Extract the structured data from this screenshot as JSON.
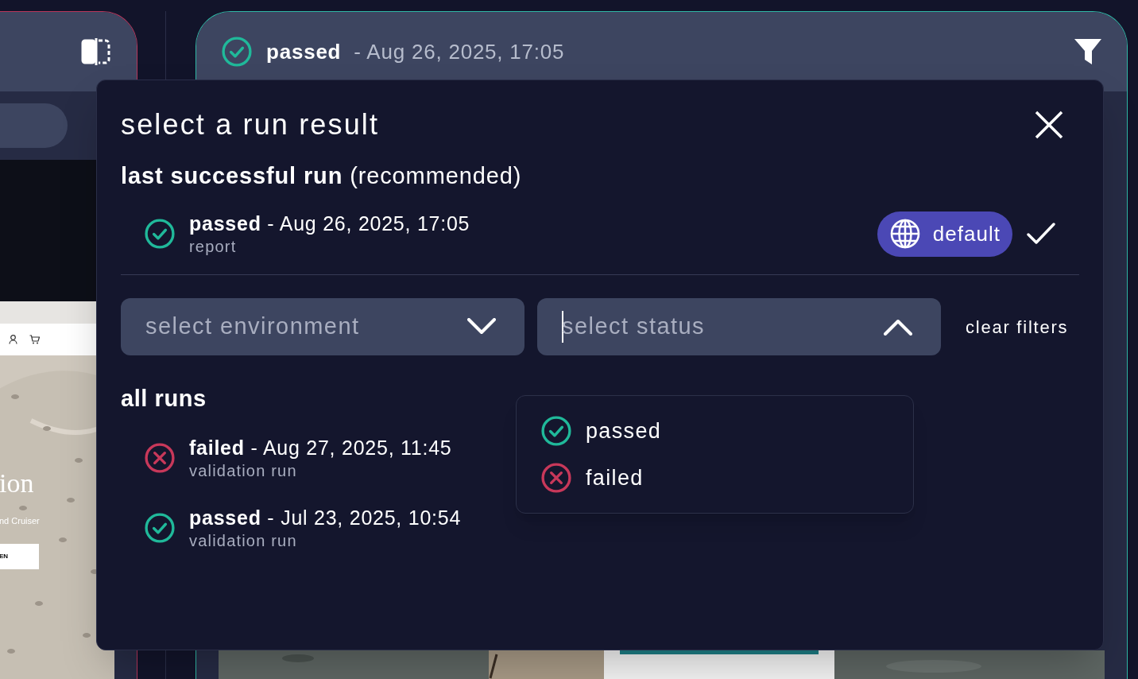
{
  "header": {
    "status": "passed",
    "kind": "passed",
    "timestamp": "- Aug 26, 2025, 17:05"
  },
  "preview": {
    "headline": "ion",
    "subline": "nd Cruiser",
    "button": "EN"
  },
  "modal": {
    "title": "select a run result",
    "recommended_heading": "**last successful run** (recommended)",
    "recommended_run": {
      "kind": "passed",
      "title": "**passed** - Aug 26, 2025, 17:05",
      "label": "report",
      "badge": "default",
      "selected": true
    },
    "filters": [
      {
        "placeholder": "select environment",
        "expanded": false,
        "focused": false
      },
      {
        "placeholder": "select status",
        "expanded": true,
        "focused": true,
        "options": [
          {
            "kind": "passed",
            "label": "passed"
          },
          {
            "kind": "failed",
            "label": "failed"
          }
        ]
      }
    ],
    "clear_filters": "clear filters",
    "all_runs_heading": "all runs",
    "runs": [
      {
        "kind": "failed",
        "title": "**failed** - Aug 27, 2025, 11:45",
        "label": "validation run",
        "selected": false
      },
      {
        "kind": "passed",
        "title": "**passed** - Jul 23, 2025, 10:54",
        "label": "validation run",
        "selected": false
      }
    ]
  }
}
